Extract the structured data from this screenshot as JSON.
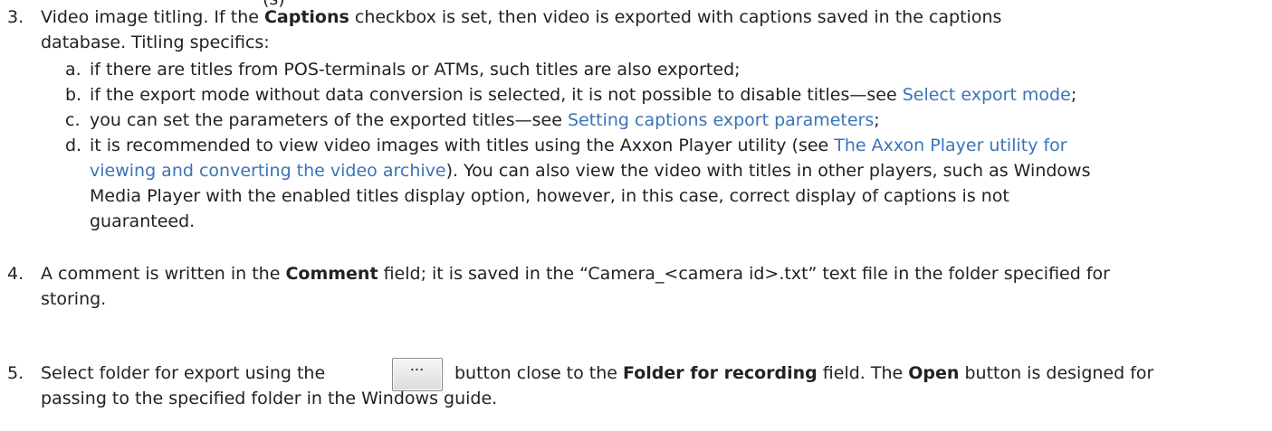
{
  "clipped_top_text": "(s)",
  "item3": {
    "number": "3.",
    "intro_1": "Video image titling. If the ",
    "captions_label": "Captions",
    "intro_2": " checkbox is set, then video is exported with captions saved in the captions",
    "intro_line2": "database. Titling specifics:",
    "subitems": [
      {
        "letter": "a.",
        "text": "if there are titles from POS-terminals or ATMs, such titles are also exported;"
      },
      {
        "letter": "b.",
        "text": "if the export mode without data conversion is selected, it is not possible to disable titles—see ",
        "link": "Select export mode",
        "after": ";"
      },
      {
        "letter": "c.",
        "text": "you can set the parameters of the exported titles—see ",
        "link": "Setting captions export parameters",
        "after": ";"
      },
      {
        "letter": "d.",
        "line1_text": "it is recommended to view video images with titles using the Axxon Player utility (see ",
        "line1_link": "The Axxon Player utility for",
        "line2_link": "viewing and converting the video archive",
        "line2_text": "). You can also view the video with titles in other players, such as Windows",
        "line3": "Media Player with the enabled titles display option, however, in this case, correct display of captions is not",
        "line4": "guaranteed."
      }
    ]
  },
  "item4": {
    "number": "4.",
    "t1": "A comment is written in the ",
    "comment_label": "Comment",
    "t2": " field; it is saved in the “Camera_<camera id>.txt” text file in the folder specified for",
    "line2": "storing."
  },
  "item5": {
    "number": "5.",
    "t1": "Select folder for export using the",
    "button_label": "...",
    "t2": " button close to the ",
    "folder_label": "Folder for recording",
    "t3": " field. The ",
    "open_label": "Open",
    "t4": " button is designed for",
    "line2": "passing to the specified folder in the Windows guide."
  }
}
